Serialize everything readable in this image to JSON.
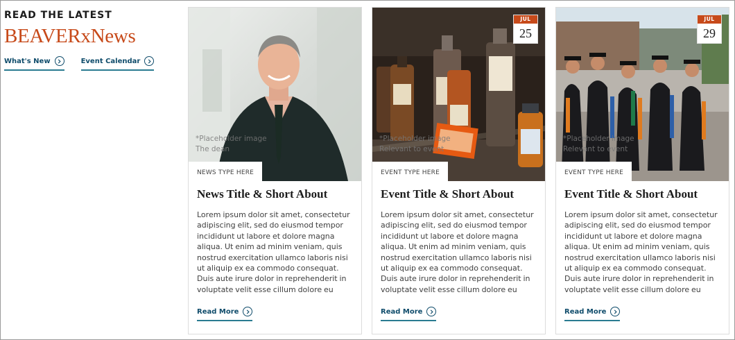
{
  "intro": {
    "eyebrow": "READ THE LATEST",
    "brand": "BEAVERxNews",
    "links": [
      {
        "label": "What's New",
        "icon": "circle-chevron-right-icon"
      },
      {
        "label": "Event Calendar",
        "icon": "circle-chevron-right-icon"
      }
    ]
  },
  "colors": {
    "accent": "#c74a1a",
    "link": "#0f4c6b",
    "underline": "#2a7b91"
  },
  "cards": [
    {
      "type": "NEWS TYPE HERE",
      "title": "News Title & Short About",
      "body": "Lorem ipsum dolor sit amet, consectetur adipiscing elit, sed do eiusmod tempor incididunt ut labore et dolore magna aliqua. Ut enim ad minim veniam, quis nostrud exercitation ullamco laboris nisi ut aliquip ex ea commodo consequat. Duis aute irure dolor in reprehenderit in voluptate velit esse cillum dolore eu fugiat nulla pariatur...",
      "more": "Read More",
      "note_line1": "*Placeholder image",
      "note_line2": "The dean"
    },
    {
      "type": "EVENT TYPE HERE",
      "title": "Event Title & Short About",
      "body": "Lorem ipsum dolor sit amet, consectetur adipiscing elit, sed do eiusmod tempor incididunt ut labore et dolore magna aliqua. Ut enim ad minim veniam, quis nostrud exercitation ullamco laboris nisi ut aliquip ex ea commodo consequat. Duis aute irure dolor in reprehenderit in voluptate velit esse cillum dolore eu fugiat nulla pariatur...",
      "more": "Read More",
      "note_line1": "*Placeholder image",
      "note_line2": "Relevant to event",
      "date_month": "JUL",
      "date_day": "25"
    },
    {
      "type": "EVENT TYPE HERE",
      "title": "Event Title & Short About",
      "body": "Lorem ipsum dolor sit amet, consectetur adipiscing elit, sed do eiusmod tempor incididunt ut labore et dolore magna aliqua. Ut enim ad minim veniam, quis nostrud exercitation ullamco laboris nisi ut aliquip ex ea commodo consequat. Duis aute irure dolor in reprehenderit in voluptate velit esse cillum dolore eu fugiat nulla pariatur...",
      "more": "Read More",
      "note_line1": "*Placeholder image",
      "note_line2": "Relevant to event",
      "date_month": "JUL",
      "date_day": "29"
    }
  ]
}
